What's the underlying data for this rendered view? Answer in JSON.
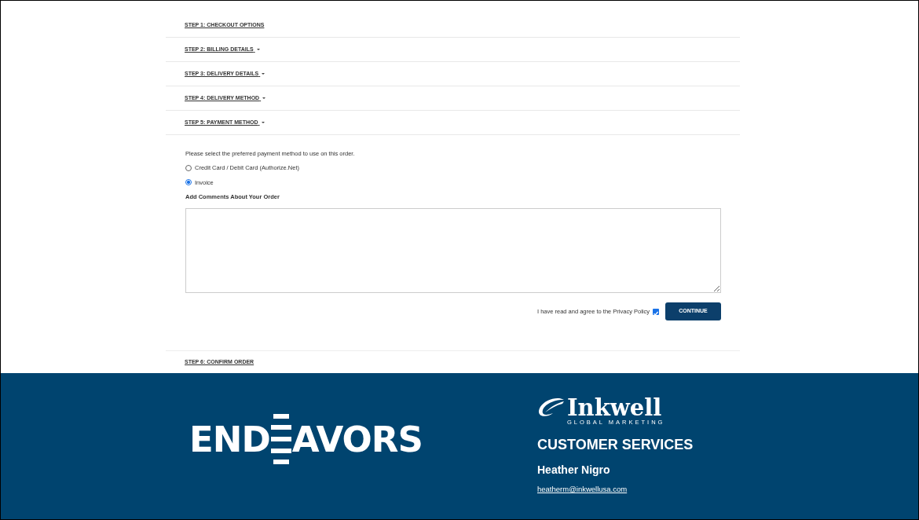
{
  "steps": [
    {
      "label": "STEP 1: CHECKOUT OPTIONS",
      "caret": false
    },
    {
      "label": "STEP 2: BILLING DETAILS",
      "caret": true
    },
    {
      "label": "STEP 3: DELIVERY DETAILS",
      "caret": true
    },
    {
      "label": "STEP 4: DELIVERY METHOD",
      "caret": true
    },
    {
      "label": "STEP 5: PAYMENT METHOD",
      "caret": true
    }
  ],
  "payment": {
    "intro": "Please select the preferred payment method to use on this order.",
    "options": [
      {
        "label": "Credit Card / Debit Card (Authorize.Net)",
        "selected": false
      },
      {
        "label": "Invoice",
        "selected": true
      }
    ],
    "comments_label": "Add Comments About Your Order",
    "agree_text": "I have read and agree to the",
    "agree_link": "Privacy Policy",
    "agree_checked": true,
    "continue_button": "CONTINUE"
  },
  "last_step": {
    "label": "STEP 6: CONFIRM ORDER"
  },
  "footer": {
    "endeavors_logo": {
      "before": "END",
      "after": "AVORS"
    },
    "inkwell_logo": {
      "name": "Inkwell",
      "tagline": "GLOBAL MARKETING"
    },
    "heading": "CUSTOMER SERVICES",
    "contact_name": "Heather Nigro",
    "email": "heatherm@inkwellusa.com"
  }
}
